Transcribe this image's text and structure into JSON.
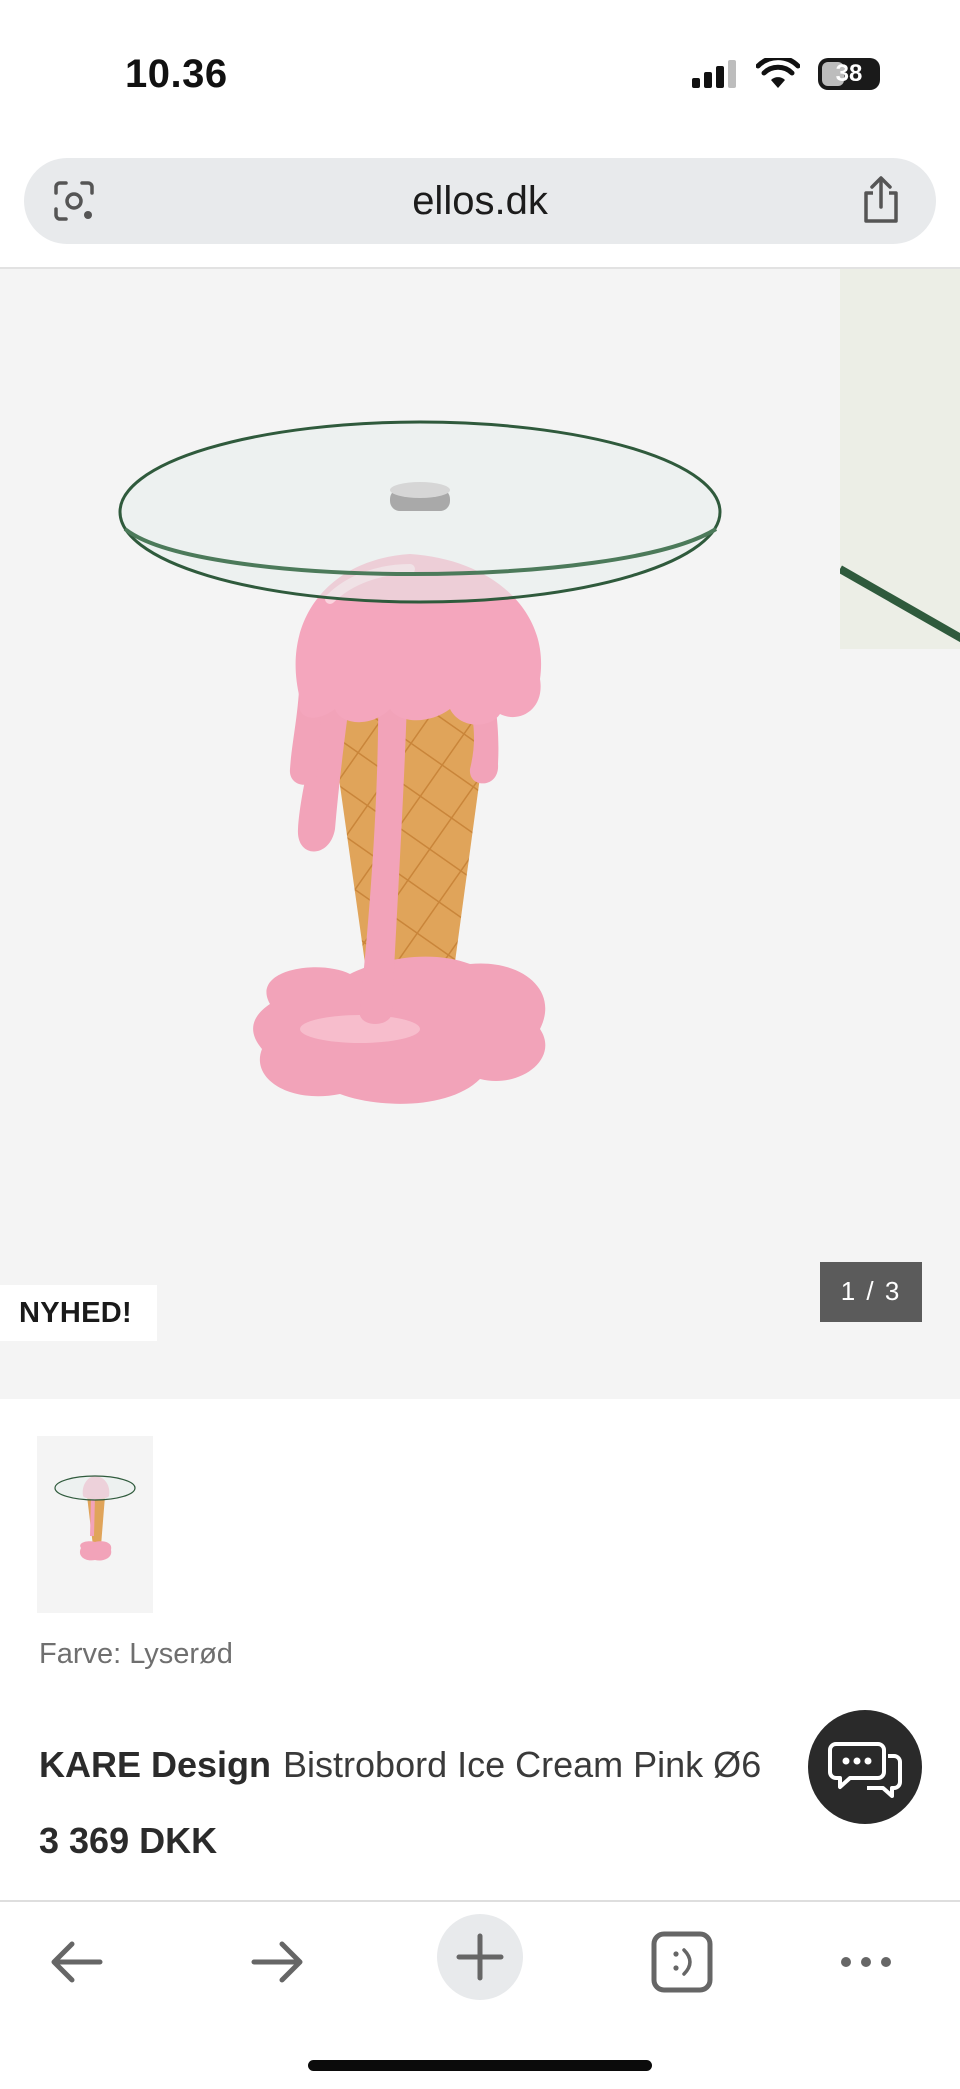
{
  "status_bar": {
    "time": "10.36",
    "battery_level": "38"
  },
  "browser": {
    "url": "ellos.dk"
  },
  "gallery": {
    "badge": "NYHED!",
    "slide_counter": "1 / 3"
  },
  "product": {
    "color_label": "Farve: Lyserød",
    "brand": "KARE Design",
    "name": "Bistrobord Ice Cream Pink Ø6",
    "price": "3 369 DKK"
  },
  "colors": {
    "accent_pink": "#f4a6bd",
    "cone": "#e0a45a",
    "counter_bg": "#5b5b5b"
  },
  "icons": {
    "lens": "camera-lens-icon",
    "share": "share-icon",
    "chat": "chat-bubbles-icon",
    "back": "arrow-left-icon",
    "forward": "arrow-right-icon",
    "new_tab": "plus-icon",
    "tabs": "tabs-icon",
    "more": "more-dots-icon"
  }
}
